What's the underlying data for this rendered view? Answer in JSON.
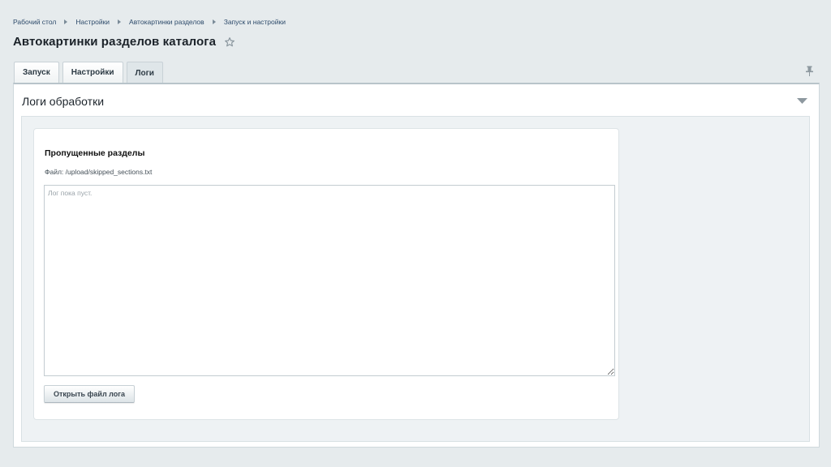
{
  "breadcrumbs": [
    "Рабочий стол",
    "Настройки",
    "Автокартинки разделов",
    "Запуск и настройки"
  ],
  "page": {
    "title": "Автокартинки разделов каталога"
  },
  "tabs": [
    {
      "label": "Запуск"
    },
    {
      "label": "Настройки"
    },
    {
      "label": "Логи",
      "active": true
    }
  ],
  "section": {
    "title": "Логи обработки"
  },
  "card": {
    "title": "Пропущенные разделы",
    "file_line": "Файл: /upload/skipped_sections.txt",
    "log_value": "",
    "log_placeholder": "Лог пока пуст.",
    "open_button": "Открыть файл лога"
  },
  "colors": {
    "background": "#e6ebed",
    "panel": "#ffffff",
    "inner": "#eef2f4"
  },
  "icons": [
    "star-icon",
    "pin-icon",
    "collapse-arrow-icon",
    "breadcrumb-arrow-icon"
  ]
}
